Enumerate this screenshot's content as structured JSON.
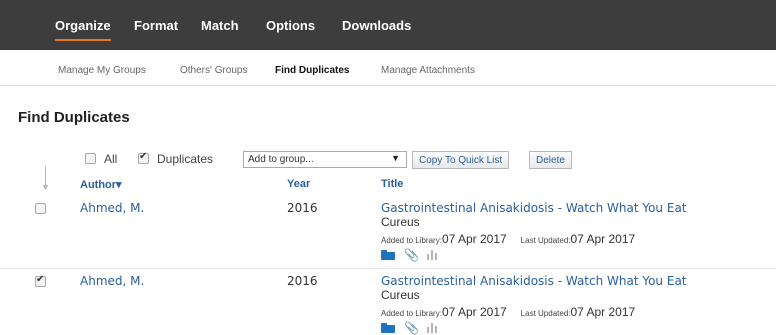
{
  "top_nav": {
    "tabs": [
      {
        "label": "Organize"
      },
      {
        "label": "Format"
      },
      {
        "label": "Match"
      },
      {
        "label": "Options"
      },
      {
        "label": "Downloads"
      }
    ],
    "active_tab": "Organize",
    "accent_color": "#e87722"
  },
  "sub_nav": {
    "items": [
      {
        "label": "Manage My Groups"
      },
      {
        "label": "Others' Groups"
      },
      {
        "label": "Find Duplicates"
      },
      {
        "label": "Manage Attachments"
      }
    ],
    "active_item": "Find Duplicates"
  },
  "page": {
    "title": "Find Duplicates"
  },
  "toolbar": {
    "all_label": "All",
    "all_checked": false,
    "duplicates_label": "Duplicates",
    "duplicates_checked": true,
    "group_select_value": "Add to group...",
    "copy_button": "Copy To Quick List",
    "delete_button": "Delete"
  },
  "columns": {
    "author": "Author",
    "author_sort_glyph": "▾",
    "year": "Year",
    "title": "Title"
  },
  "rows": [
    {
      "checked": false,
      "author": "Ahmed, M.",
      "year": "2016",
      "title": "Gastrointestinal Anisakidosis - Watch What You Eat",
      "journal": "Cureus",
      "added_label": "Added to Library:",
      "added_date": "07 Apr 2017",
      "updated_label": "Last Updated:",
      "updated_date": "07 Apr 2017",
      "icons": [
        "folder-icon",
        "paperclip-icon",
        "bar-chart-icon"
      ]
    },
    {
      "checked": true,
      "author": "Ahmed, M.",
      "year": "2016",
      "title": "Gastrointestinal Anisakidosis - Watch What You Eat",
      "journal": "Cureus",
      "added_label": "Added to Library:",
      "added_date": "07 Apr 2017",
      "updated_label": "Last Updated:",
      "updated_date": "07 Apr 2017",
      "icons": [
        "folder-icon",
        "paperclip-icon",
        "bar-chart-icon"
      ]
    }
  ]
}
